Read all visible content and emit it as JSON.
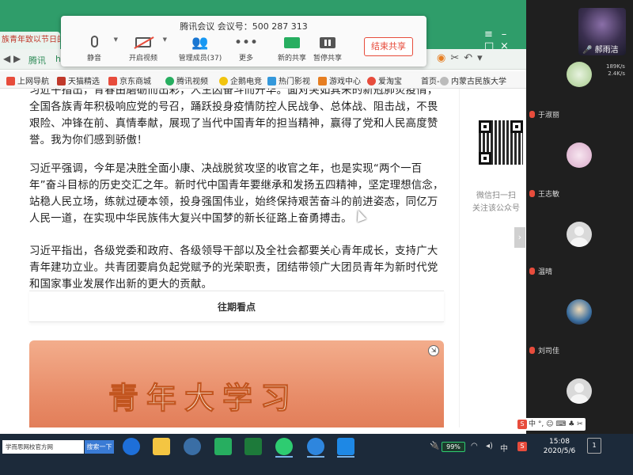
{
  "browser": {
    "active_tab": "族青年致以节日的",
    "site_tag": "腾讯",
    "site_h": "h",
    "bookmarks": [
      "上网导航",
      "天猫精选",
      "京东商城",
      "腾讯视频",
      "企鹅电竞",
      "热门影视",
      "游戏中心",
      "爱淘宝",
      "首页-",
      "内蒙古民族大学"
    ]
  },
  "meeting": {
    "title": "腾讯会议 会议号：500 287 313",
    "buttons": {
      "mute": "静音",
      "start_video": "开启视频",
      "manage_members": "管理成员(37)",
      "more": "更多",
      "new_share": "新的共享",
      "pause_share": "暂停共享",
      "end_share": "结束共享"
    }
  },
  "article": {
    "p1": "习近平指出，青春由磨砺而出彩，人生因奋斗而升华。面对突如其来的新冠肺炎疫情，全国各族青年积极响应党的号召，踊跃投身疫情防控人民战争、总体战、阻击战，不畏艰险、冲锋在前、真情奉献，展现了当代中国青年的担当精神，赢得了党和人民高度赞誉。我为你们感到骄傲！",
    "p2": "习近平强调，今年是决胜全面小康、决战脱贫攻坚的收官之年，也是实现“两个一百年”奋斗目标的历史交汇之年。新时代中国青年要继承和发扬五四精神，坚定理想信念，站稳人民立场，练就过硬本领，投身强国伟业，始终保持艰苦奋斗的前进姿态，同亿万人民一道，在实现中华民族伟大复兴中国梦的新长征路上奋勇搏击。",
    "p3": "习近平指出，各级党委和政府、各级领导干部以及全社会都要关心青年成长，支持广大青年建功立业。共青团要肩负起党赋予的光荣职责，团结带领广大团员青年为新时代党和国家事业发展作出新的更大的贡献。",
    "past_header": "往期看点",
    "banner_text": "青年大学习"
  },
  "qr": {
    "line1": "微信扫一扫",
    "line2": "关注该公众号"
  },
  "participants": {
    "self_name": "郝雨洁",
    "net_stat_1": "189K/s",
    "net_stat_2": "2.4K/s",
    "list": [
      {
        "name": "于淑丽"
      },
      {
        "name": "王志敏"
      },
      {
        "name": "温晴"
      },
      {
        "name": "刘司佳"
      }
    ]
  },
  "taskbar": {
    "search_text": "学而思网校官方网",
    "search_button": "搜索一下",
    "battery": "99%",
    "ime": "中",
    "time": "15:08",
    "date": "2020/5/6",
    "notif_count": "1"
  },
  "ime_float": {
    "lang": "中",
    "extra": "°, ☺ ⌨ ♣ ✂"
  }
}
